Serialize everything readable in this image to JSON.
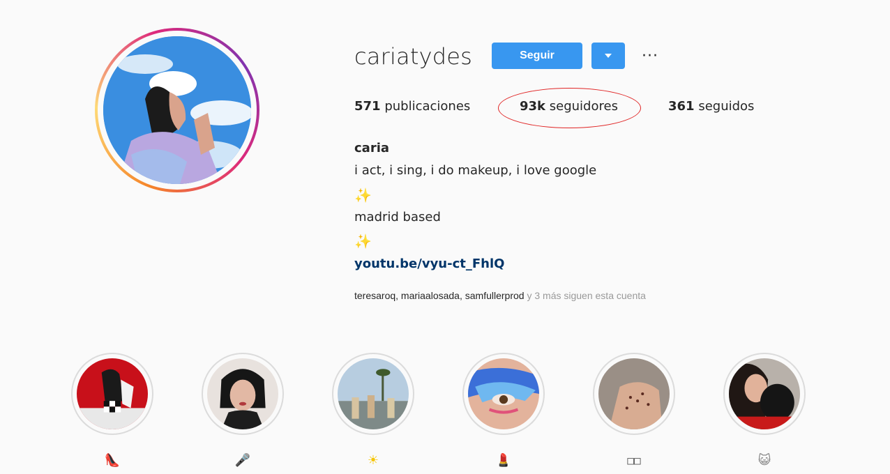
{
  "profile": {
    "username": "cariatydes",
    "follow_label": "Seguir",
    "more_label": "···",
    "stats": {
      "posts_count": "571",
      "posts_label": "publicaciones",
      "followers_count": "93k",
      "followers_label": "seguidores",
      "following_count": "361",
      "following_label": "seguidos"
    },
    "bio": {
      "name": "caria",
      "line1": "i act, i sing, i do makeup, i love google",
      "sparkle1": "✨",
      "line2": "madrid based",
      "sparkle2": "✨",
      "link": "youtu.be/vyu-ct_FhlQ"
    },
    "followed_by": {
      "names": "teresaroq, mariaalosada, samfullerprod",
      "suffix": "y 3 más siguen esta cuenta"
    }
  },
  "highlights": [
    {
      "icon": "high-heel-icon",
      "glyph": "👠"
    },
    {
      "icon": "microphone-icon",
      "glyph": "🎤"
    },
    {
      "icon": "sun-icon",
      "glyph": "☀"
    },
    {
      "icon": "lipstick-icon",
      "glyph": "💄"
    },
    {
      "icon": "boxes-icon",
      "glyph": "□□"
    },
    {
      "icon": "cat-icon",
      "glyph": "😺"
    }
  ],
  "colors": {
    "accent": "#3897f0",
    "link": "#003569",
    "annotation": "#e02424"
  }
}
